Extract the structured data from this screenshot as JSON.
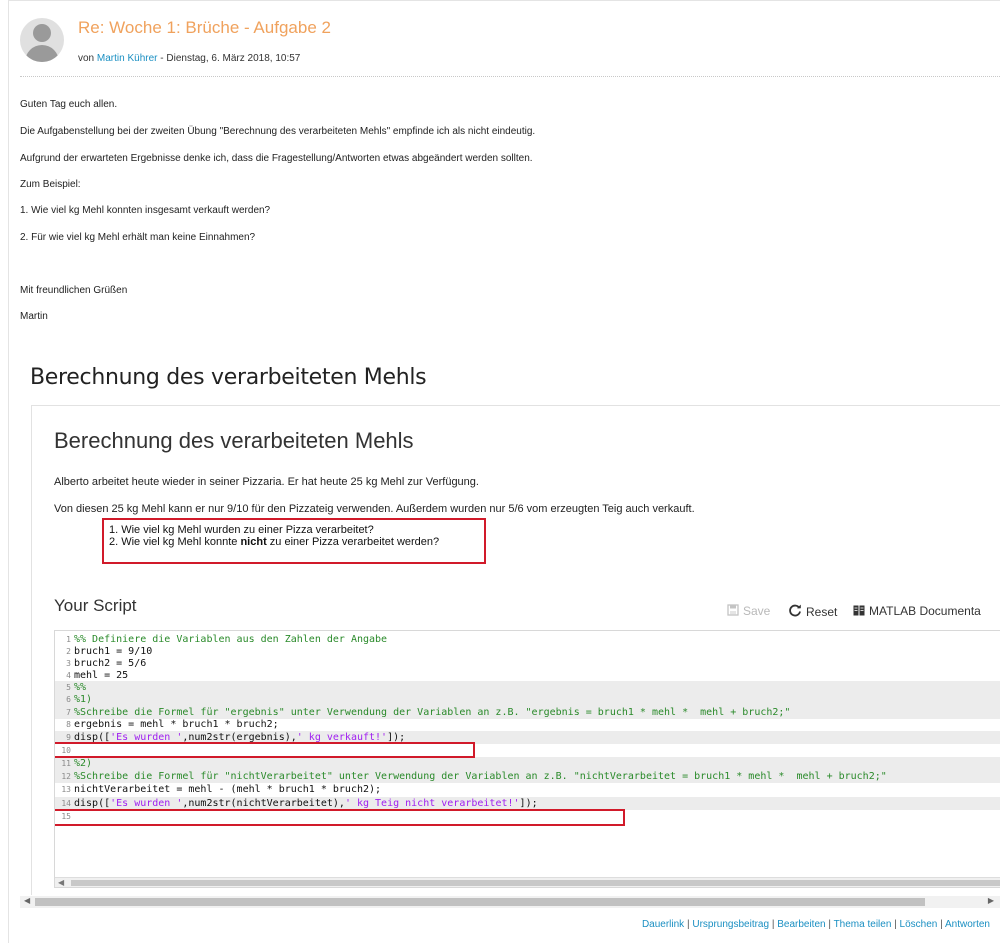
{
  "post": {
    "subject": "Re: Woche 1: Brüche - Aufgabe 2",
    "by_prefix": "von",
    "author": "Martin Kührer",
    "date_suffix": "- Dienstag, 6. März 2018, 10:57",
    "body": [
      "Guten Tag euch allen.",
      "Die Aufgabenstellung bei der zweiten Übung \"Berechnung des verarbeiteten Mehls\" empfinde ich als nicht eindeutig.",
      "Aufgrund der erwarteten Ergebnisse denke ich, dass die Fragestellung/Antworten etwas abgeändert werden sollten.",
      "Zum Beispiel:",
      "1. Wie viel kg Mehl konnten insgesamt verkauft werden?",
      "2. Für wie viel kg Mehl erhält man keine Einnahmen?",
      "Mit freundlichen Grüßen",
      "Martin"
    ]
  },
  "attachment": {
    "heading": "Berechnung des verarbeiteten Mehls",
    "title": "Berechnung des verarbeiteten Mehls",
    "para1": "Alberto arbeitet heute wieder in seiner Pizzaria. Er hat heute 25 kg Mehl zur Verfügung.",
    "para2": "Von diesen 25 kg Mehl kann er nur 9/10 für den Pizzateig verwenden. Außerdem wurden nur 5/6 vom erzeugten Teig auch verkauft.",
    "q1": "1. Wie viel kg Mehl wurden zu einer Pizza verarbeitet?",
    "q2_before": "2. Wie viel kg Mehl konnte ",
    "q2_bold": "nicht",
    "q2_after": " zu einer Pizza verarbeitet werden?",
    "script_heading": "Your Script",
    "toolbar": {
      "save": "Save",
      "reset": "Reset",
      "doc": "MATLAB Documenta"
    }
  },
  "code": {
    "lines": [
      {
        "n": "1",
        "segs": [
          {
            "t": "c",
            "v": "%% Definiere die Variablen aus den Zahlen der Angabe"
          }
        ]
      },
      {
        "n": "2",
        "segs": [
          {
            "t": "k",
            "v": "bruch1 = 9/10"
          }
        ]
      },
      {
        "n": "3",
        "segs": [
          {
            "t": "k",
            "v": "bruch2 = 5/6"
          }
        ]
      },
      {
        "n": "4",
        "segs": [
          {
            "t": "k",
            "v": "mehl = 25"
          }
        ]
      },
      {
        "n": "5",
        "segs": [
          {
            "t": "c",
            "v": "%%"
          }
        ]
      },
      {
        "n": "6",
        "segs": [
          {
            "t": "c",
            "v": "%1)"
          }
        ]
      },
      {
        "n": "7",
        "segs": [
          {
            "t": "c",
            "v": "%Schreibe die Formel für \"ergebnis\" unter Verwendung der Variablen an z.B. \"ergebnis = bruch1 * mehl *  mehl + bruch2;\""
          }
        ]
      },
      {
        "n": "8",
        "segs": [
          {
            "t": "k",
            "v": "ergebnis = mehl * bruch1 * bruch2;"
          }
        ]
      },
      {
        "n": "9",
        "segs": [
          {
            "t": "k",
            "v": "disp(["
          },
          {
            "t": "s",
            "v": "'Es wurden '"
          },
          {
            "t": "k",
            "v": ",num2str(ergebnis),"
          },
          {
            "t": "s",
            "v": "' kg verkauft!'"
          },
          {
            "t": "k",
            "v": "]);"
          }
        ]
      },
      {
        "n": "10",
        "segs": []
      },
      {
        "n": "11",
        "segs": [
          {
            "t": "c",
            "v": "%2)"
          }
        ]
      },
      {
        "n": "12",
        "segs": [
          {
            "t": "c",
            "v": "%Schreibe die Formel für \"nichtVerarbeitet\" unter Verwendung der Variablen an z.B. \"nichtVerarbeitet = bruch1 * mehl *  mehl + bruch2;\""
          }
        ]
      },
      {
        "n": "13",
        "segs": [
          {
            "t": "k",
            "v": "nichtVerarbeitet = mehl - (mehl * bruch1 * bruch2);"
          }
        ]
      },
      {
        "n": "14",
        "segs": [
          {
            "t": "k",
            "v": "disp(["
          },
          {
            "t": "s",
            "v": "'Es wurden '"
          },
          {
            "t": "k",
            "v": ",num2str(nichtVerarbeitet),"
          },
          {
            "t": "s",
            "v": "' kg Teig nicht verarbeitet!'"
          },
          {
            "t": "k",
            "v": "]);"
          }
        ]
      },
      {
        "n": "15",
        "segs": []
      }
    ]
  },
  "footer": {
    "links": [
      "Dauerlink",
      "Ursprungsbeitrag",
      "Bearbeiten",
      "Thema teilen",
      "Löschen",
      "Antworten"
    ]
  }
}
